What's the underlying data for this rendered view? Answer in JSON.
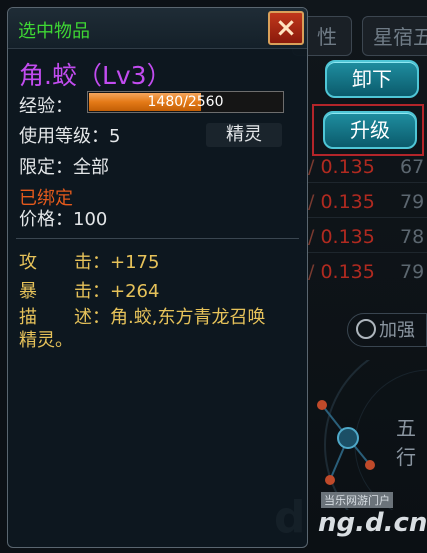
{
  "tooltip": {
    "title": "选中物品",
    "close_icon": "×",
    "item_name": "角.蛟（Lv3）",
    "xp_label": "经验：",
    "xp_text": "1480/2560",
    "xp_progress": 0.578,
    "level_req": "使用等级：5",
    "type_badge": "精灵",
    "restriction": "限定：全部",
    "bound_status": "已绑定",
    "price": "价格：100",
    "stats": [
      {
        "k1": "攻",
        "k2": "击：+175"
      },
      {
        "k1": "暴",
        "k2": "击：+264"
      },
      {
        "k1": "描",
        "k2": "述：角.蛟,东方青龙召唤"
      }
    ],
    "description_cont": "精灵。"
  },
  "background": {
    "tab1": "性",
    "tab2": "星宿五",
    "unload_button": "卸下",
    "upgrade_button": "升级",
    "rows": [
      {
        "slash": "/",
        "value": "0.135",
        "right": "67"
      },
      {
        "slash": "/",
        "value": "0.135",
        "right": "79"
      },
      {
        "slash": "/",
        "value": "0.135",
        "right": "78"
      },
      {
        "slash": "/",
        "value": "0.135",
        "right": "79"
      }
    ],
    "strengthen_label": "加强",
    "wuxing_label": "五行",
    "watermark_small": "当乐网游门户",
    "watermark_big": "ng.d.cn",
    "watermark_letter": "d"
  },
  "colors": {
    "title_green": "#3ed634",
    "item_purple": "#c24cf0",
    "bound_orange": "#e45a1c",
    "stat_gold": "#e6c25a",
    "value_red": "#b02a20"
  }
}
